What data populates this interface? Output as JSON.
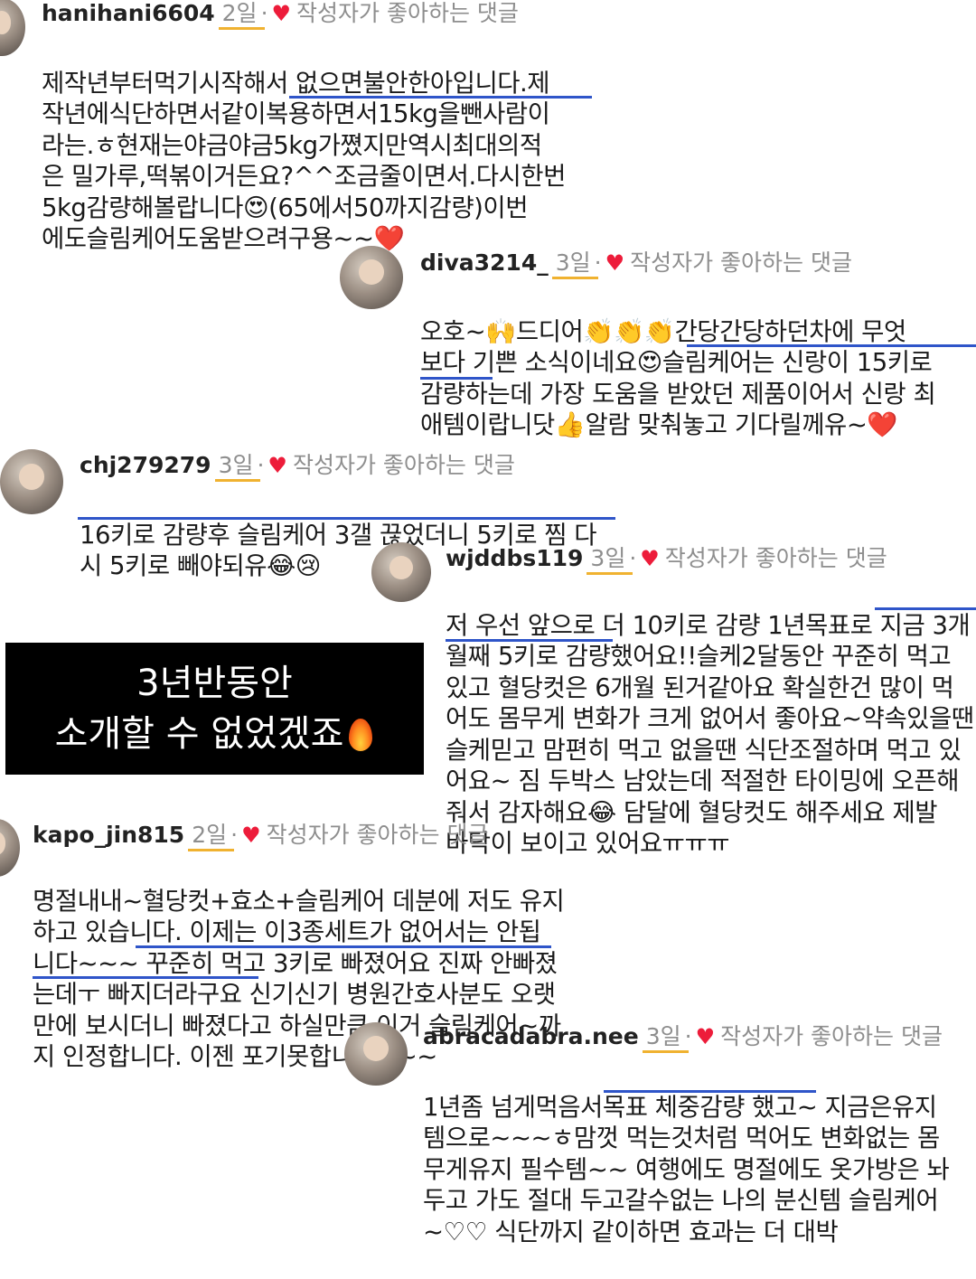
{
  "liked_label": "작성자가 좋아하는 댓글",
  "heart_icon": "♥",
  "colors": {
    "heart": "#ed1c3a",
    "underline_blue": "#2f55c9",
    "underline_yellow": "#f0b230",
    "meta_gray": "#8e8e8e",
    "overlay_bg": "#000000"
  },
  "comments": [
    {
      "username": "hanihani6604",
      "time": "2일",
      "lines": [
        "제작년부터먹기시작해서 없으면불안한아입니다.제",
        "작년에식단하면서같이복용하면서15kg을뺀사람이",
        "라는.ㅎ현재는야금야금5kg가쪘지만역시최대의적",
        "은 밀가루,떡볶이거든요?^^조금줄이면서.다시한번",
        "5kg감량해볼랍니다😍(65에서50까지감량)이번",
        "에도슬림케어도움받으려구용~~❤️"
      ]
    },
    {
      "username": "diva3214_",
      "time": "3일",
      "lines": [
        "오호~🙌드디어👏👏👏간당간당하던차에 무엇",
        "보다 기쁜 소식이네요😍슬림케어는 신랑이 15키로",
        "감량하는데 가장 도움을 받았던 제품이어서 신랑 최",
        "애템이랍니닷👍알람 맞춰놓고 기다릴께유~❤️"
      ]
    },
    {
      "username": "chj279279",
      "time": "3일",
      "lines": [
        "16키로 감량후 슬림케어 3갤 끊었더니 5키로 찜 다",
        "시 5키로 빼야되유😂😢"
      ]
    },
    {
      "username": "wjddbs119",
      "time": "3일",
      "lines": [
        "저 우선 앞으로 더 10키로 감량 1년목표로 지금 3개",
        "월째 5키로 감량했어요!!슬케2달동안 꾸준히 먹고",
        "있고 혈당컷은 6개월 된거같아요 확실한건 많이 먹",
        "어도 몸무게 변화가 크게 없어서 좋아요~약속있을땐",
        "슬케믿고 맘편히 먹고 없을땐 식단조절하며 먹고 있",
        "어요~ 짐 두박스 남았는데 적절한 타이밍에 오픈해",
        "줘서 감자해요😂 담달에 혈당컷도 해주세요 제발",
        "바닥이 보이고 있어요ㅠㅠㅠ"
      ]
    },
    {
      "username": "kapo_jin815",
      "time": "2일",
      "lines": [
        "명절내내~혈당컷+효소+슬림케어 데분에 저도 유지",
        "하고 있습니다. 이제는 이3종세트가 없어서는 안됩",
        "니다~~~ 꾸준히 먹고 3키로 빠졌어요 진짜 안빠졌",
        "는데ㅜ 빠지더라구요 신기신기 병원간호사분도 오랫",
        "만에 보시더니 빠졌다고 하실만큼 이거 슬림케어~까",
        "지 인정합니다. 이젠 포기못합니다~~~"
      ]
    },
    {
      "username": "abracadabra.nee",
      "time": "3일",
      "lines": [
        "1년좀 넘게먹음서목표 체중감량 했고~ 지금은유지",
        "템으로~~~ㅎ맘껏 먹는것처럼 먹어도 변화없는 몸",
        "무게유지 필수템~~ 여행에도 명절에도 옷가방은 놔",
        "두고 가도 절대 두고갈수없는 나의 분신템 슬림케어",
        "~♡♡ 식단까지 같이하면 효과는 더 대박"
      ]
    }
  ],
  "overlay": {
    "line1": "3년반동안",
    "line2": "소개할 수 없었겠죠",
    "emoji_icon": "fire-icon"
  }
}
